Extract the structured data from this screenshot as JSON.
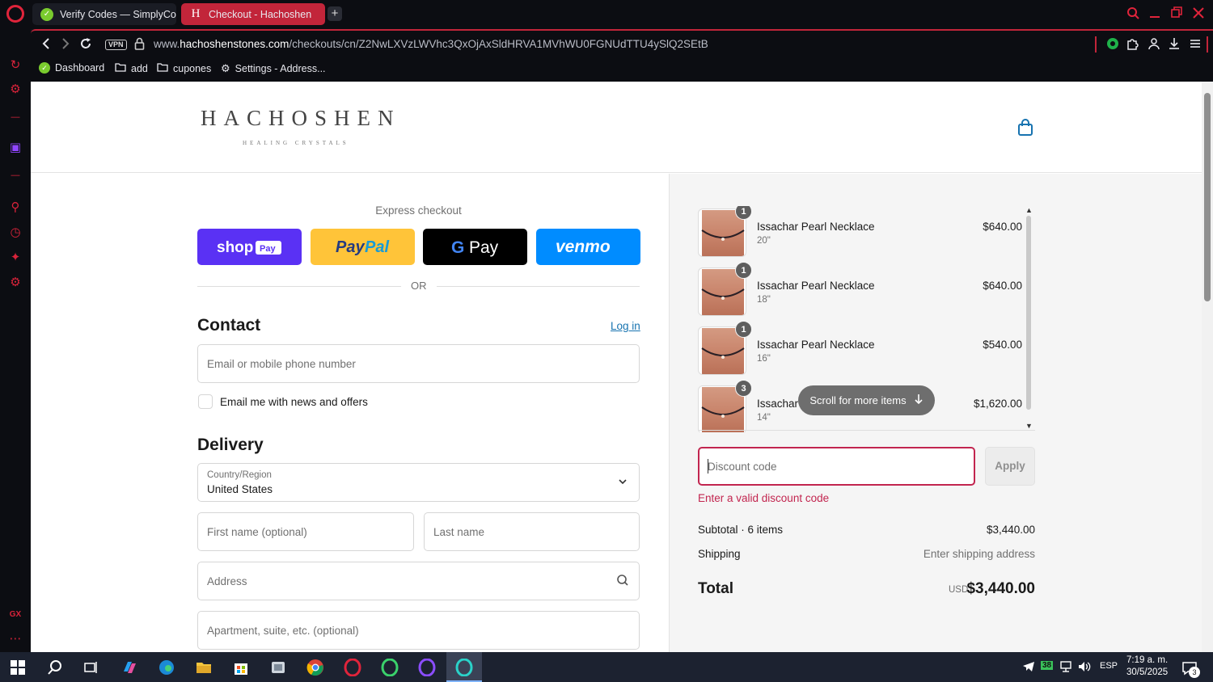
{
  "browser": {
    "tabs": [
      {
        "label": "Verify Codes — SimplyCo"
      },
      {
        "label": "Checkout - Hachoshen"
      }
    ],
    "url_prefix": "www.",
    "url_domain": "hachoshenstones.com",
    "url_path": "/checkouts/cn/Z2NwLXVzLWVhc3QxOjAxSldHRVA1MVhWU0FGNUdTTU4ySlQ2SEtB",
    "vpn_label": "VPN",
    "bookmarks": [
      {
        "label": "Dashboard",
        "icon": "simplycodes-icon"
      },
      {
        "label": "add",
        "icon": "folder-icon"
      },
      {
        "label": "cupones",
        "icon": "folder-icon"
      },
      {
        "label": "Settings - Address...",
        "icon": "gear-icon"
      }
    ]
  },
  "store": {
    "logo_title": "HACHOSHEN",
    "logo_subtitle": "HEALING CRYSTALS"
  },
  "checkout": {
    "express_title": "Express checkout",
    "or_text": "OR",
    "contact_heading": "Contact",
    "login_link": "Log in",
    "email_placeholder": "Email or mobile phone number",
    "news_checkbox_label": "Email me with news and offers",
    "delivery_heading": "Delivery",
    "country_label": "Country/Region",
    "country_value": "United States",
    "first_name_placeholder": "First name (optional)",
    "last_name_placeholder": "Last name",
    "address_placeholder": "Address",
    "apartment_placeholder": "Apartment, suite, etc. (optional)"
  },
  "summary": {
    "items": [
      {
        "qty": "1",
        "name": "Issachar Pearl Necklace",
        "variant": "20\"",
        "price": "$640.00"
      },
      {
        "qty": "1",
        "name": "Issachar Pearl Necklace",
        "variant": "18\"",
        "price": "$640.00"
      },
      {
        "qty": "1",
        "name": "Issachar Pearl Necklace",
        "variant": "16\"",
        "price": "$540.00"
      },
      {
        "qty": "3",
        "name": "Issachar",
        "variant": "14\"",
        "price": "$1,620.00"
      }
    ],
    "scroll_hint": "Scroll for more items",
    "discount_placeholder": "Discount code",
    "apply_label": "Apply",
    "discount_error": "Enter a valid discount code",
    "subtotal_label": "Subtotal · 6 items",
    "subtotal_value": "$3,440.00",
    "shipping_label": "Shipping",
    "shipping_value": "Enter shipping address",
    "total_label": "Total",
    "total_currency": "USD",
    "total_value": "$3,440.00"
  },
  "taskbar": {
    "language": "ESP",
    "time": "7:19 a. m.",
    "date": "30/5/2025",
    "notifications": "3"
  },
  "colors": {
    "opera_red": "#e0243b",
    "error": "#c2254f",
    "link": "#1773b0",
    "shop_pay": "#5a31f4",
    "paypal": "#ffc439",
    "venmo": "#008cff"
  }
}
